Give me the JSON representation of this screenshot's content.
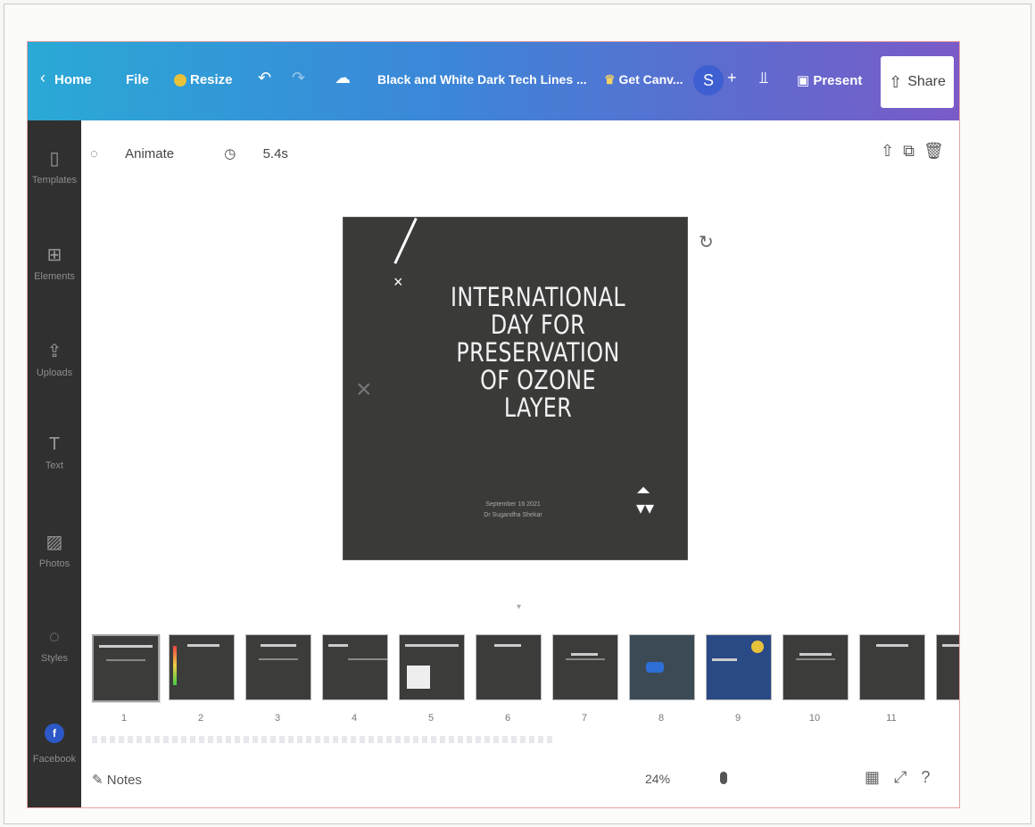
{
  "topbar": {
    "home_label": "Home",
    "back_icon": "chevron-left-icon",
    "file_label": "File",
    "resize_label": "Resize",
    "doc_title": "Black and White Dark Tech Lines ...",
    "get_canva_label": "Get Canv...",
    "avatar_initial": "S",
    "present_label": "Present",
    "share_label": "Share"
  },
  "sidebar": {
    "items": [
      {
        "label": "Templates",
        "icon": "templates-icon"
      },
      {
        "label": "Elements",
        "icon": "elements-icon"
      },
      {
        "label": "Uploads",
        "icon": "upload-icon"
      },
      {
        "label": "Text",
        "icon": "text-icon"
      },
      {
        "label": "Photos",
        "icon": "photos-icon"
      },
      {
        "label": "Styles",
        "icon": "styles-icon"
      },
      {
        "label": "Facebook",
        "icon": "facebook-icon"
      }
    ]
  },
  "editor": {
    "animate_label": "Animate",
    "duration": "5.4s"
  },
  "slide": {
    "title_lines": [
      "INTERNATIONAL",
      "DAY FOR",
      "PRESERVATION",
      "OF OZONE",
      "LAYER"
    ],
    "subtitle_date": "September 16 2021",
    "subtitle_author": "Dr Sugandha Shekar"
  },
  "thumbnails": [
    "1",
    "2",
    "3",
    "4",
    "5",
    "6",
    "7",
    "8",
    "9",
    "10",
    "11"
  ],
  "bottom": {
    "notes_label": "Notes",
    "zoom": "24%"
  },
  "colors": {
    "topbar_start": "#2aa9d6",
    "topbar_end": "#7a5bc8",
    "sidebar_bg": "#2f302f",
    "slide_bg": "#3a3b39"
  }
}
